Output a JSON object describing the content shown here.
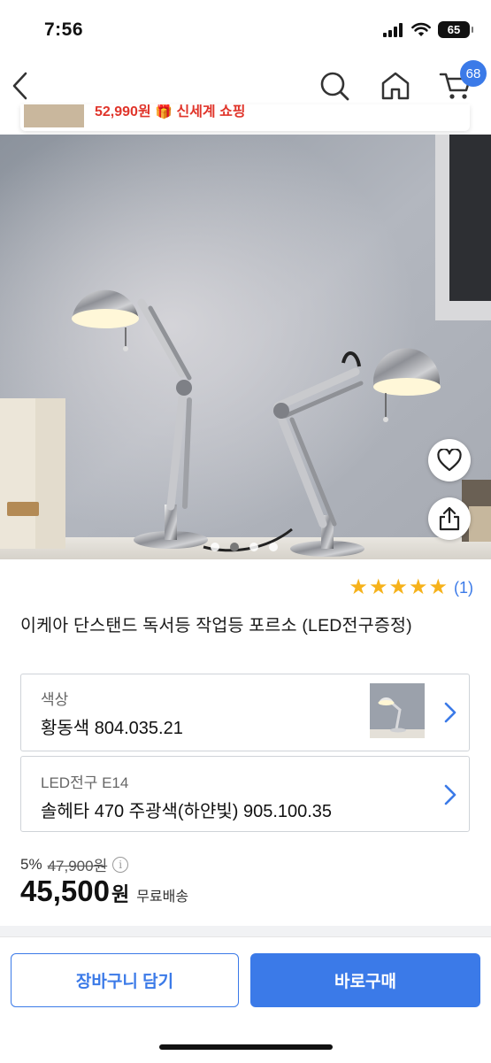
{
  "status": {
    "time": "7:56",
    "battery": "65"
  },
  "nav": {
    "cart_count": "68"
  },
  "promo": {
    "text": "52,990원 🎁 신세계 쇼핑"
  },
  "gallery": {
    "count": 4,
    "active_index": 1
  },
  "rating": {
    "stars": 5,
    "count": "(1)"
  },
  "product": {
    "title": "이케아 단스탠드 독서등 작업등 포르소 (LED전구증정)"
  },
  "options": [
    {
      "label": "색상",
      "value": "황동색 804.035.21"
    },
    {
      "label": "LED전구 E14",
      "value": "솔헤타 470 주광색(하얀빛) 905.100.35"
    }
  ],
  "price": {
    "discount": "5%",
    "original": "47,900원",
    "current": "45,500",
    "currency": "원",
    "shipping": "무료배송"
  },
  "actions": {
    "cart": "장바구니 담기",
    "buy": "바로구매"
  },
  "colors": {
    "accent": "#3b7ae8",
    "star": "#f6b21b"
  }
}
